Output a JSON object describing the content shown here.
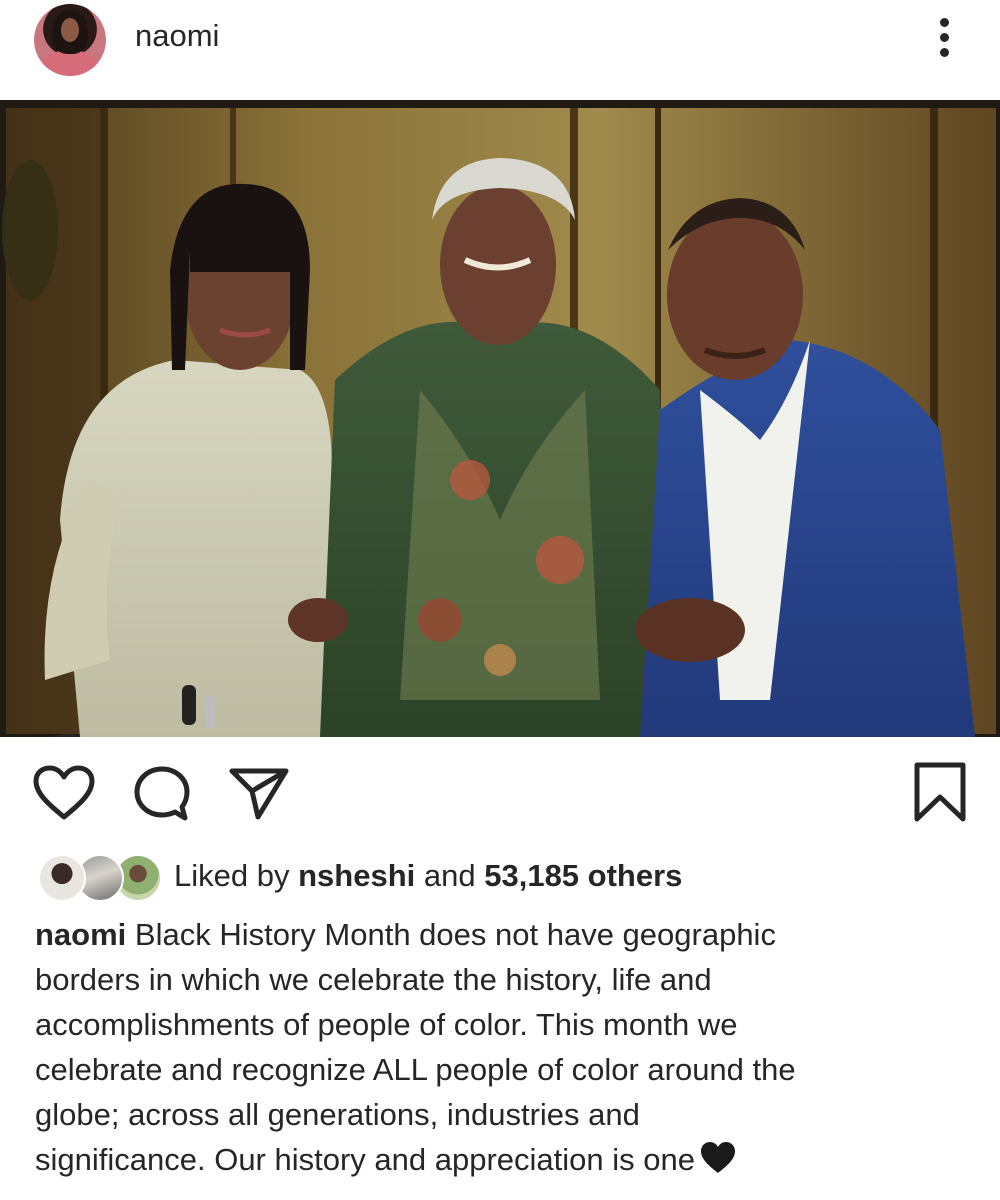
{
  "header": {
    "username": "naomi",
    "avatar_icon": "profile-avatar",
    "more_icon": "more-vertical-icon"
  },
  "post": {
    "photo_description_icon": "photo",
    "tag_icon": "user-tag-icon"
  },
  "actions": {
    "like_icon": "heart-icon",
    "comment_icon": "comment-icon",
    "share_icon": "send-icon",
    "save_icon": "bookmark-icon"
  },
  "likes": {
    "prefix": "Liked by",
    "liker": "nsheshi",
    "joiner": "and",
    "others": "53,185 others"
  },
  "caption": {
    "username": "naomi",
    "lines": [
      "Black History Month does not have geographic",
      "borders in which we celebrate the history, life and",
      "accomplishments of people of color.  This month we",
      "celebrate and recognize ALL people of color around the",
      "globe; across all generations, industries and",
      "significance.  Our history and appreciation is one"
    ],
    "emoji": "black-heart-icon"
  },
  "colors": {
    "text": "#262626",
    "background": "#ffffff"
  }
}
